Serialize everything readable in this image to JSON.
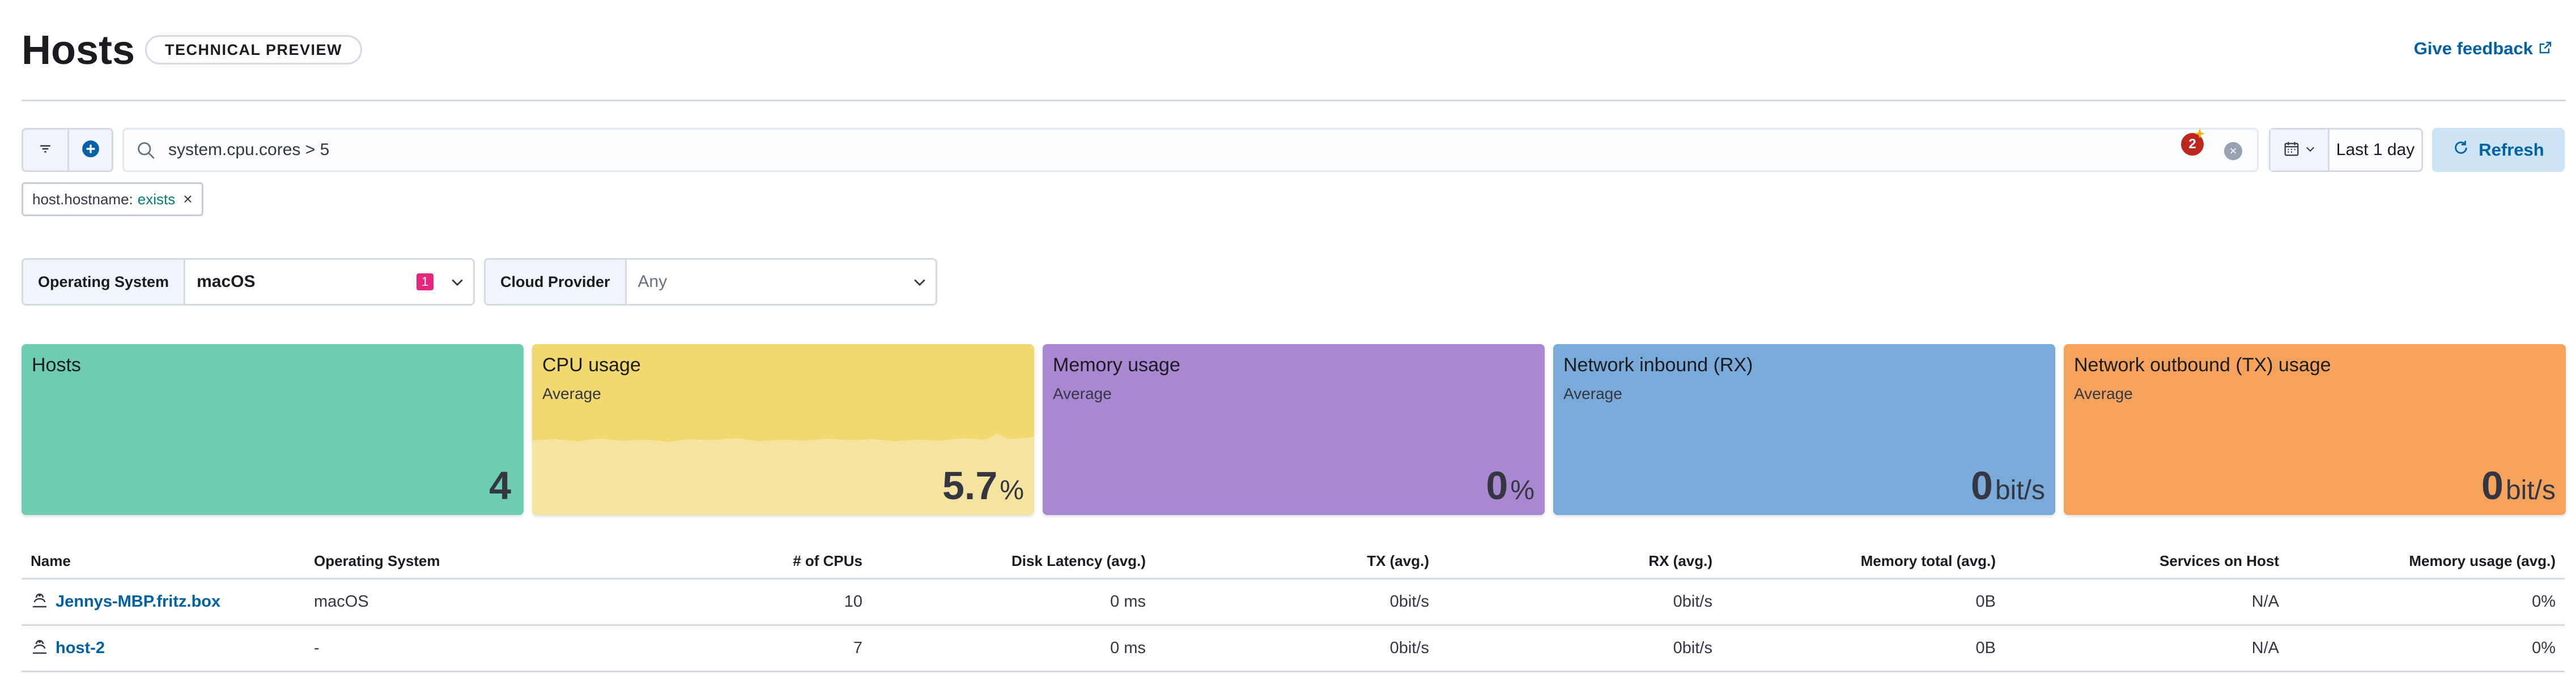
{
  "header": {
    "title": "Hosts",
    "badge": "TECHNICAL PREVIEW",
    "feedback": "Give feedback"
  },
  "query": {
    "text": "system.cpu.cores > 5",
    "badge_count": "2",
    "date_range": "Last 1 day",
    "refresh_label": "Refresh"
  },
  "pill": {
    "field": "host.hostname:",
    "value": "exists"
  },
  "controls": {
    "os": {
      "label": "Operating System",
      "value": "macOS",
      "count": "1"
    },
    "cloud": {
      "label": "Cloud Provider",
      "value": "Any"
    }
  },
  "tiles": [
    {
      "title": "Hosts",
      "subtitle": "",
      "value": "4",
      "unit": "",
      "color": "#6dccb1"
    },
    {
      "title": "CPU usage",
      "subtitle": "Average",
      "value": "5.7",
      "unit": "%",
      "color": "#f1d86f"
    },
    {
      "title": "Memory usage",
      "subtitle": "Average",
      "value": "0",
      "unit": "%",
      "color": "#a987d1"
    },
    {
      "title": "Network inbound (RX)",
      "subtitle": "Average",
      "value": "0",
      "unit": "bit/s",
      "color": "#79aad9"
    },
    {
      "title": "Network outbound (TX) usage",
      "subtitle": "Average",
      "value": "0",
      "unit": "bit/s",
      "color": "#f5a35c"
    }
  ],
  "table": {
    "columns": [
      "Name",
      "Operating System",
      "# of CPUs",
      "Disk Latency (avg.)",
      "TX (avg.)",
      "RX (avg.)",
      "Memory total (avg.)",
      "Services on Host",
      "Memory usage (avg.)"
    ],
    "rows": [
      [
        "Jennys-MBP.fritz.box",
        "macOS",
        "10",
        "0 ms",
        "0bit/s",
        "0bit/s",
        "0B",
        "N/A",
        "0%"
      ],
      [
        "host-2",
        "-",
        "7",
        "0 ms",
        "0bit/s",
        "0bit/s",
        "0B",
        "N/A",
        "0%"
      ]
    ]
  },
  "colors": {
    "accent": "#0061a6",
    "notification": "#bd271e",
    "count_badge": "#e7257f"
  }
}
